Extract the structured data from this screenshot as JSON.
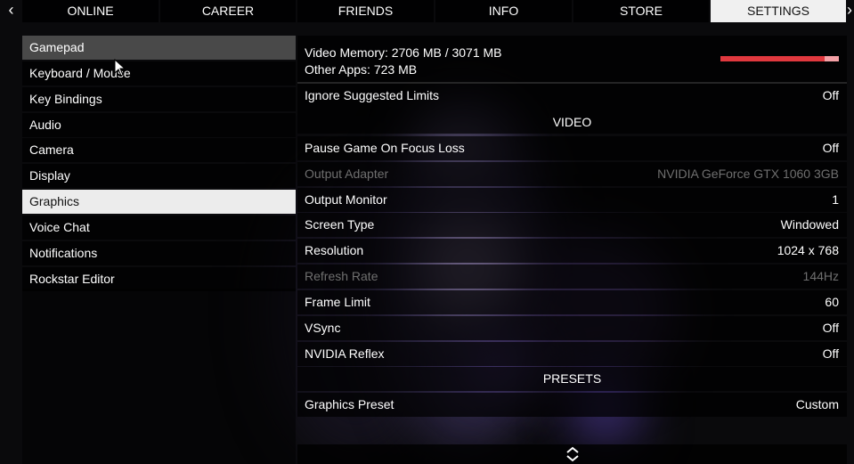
{
  "nav": {
    "prev_arrow": "‹",
    "next_arrow": "›",
    "tabs": [
      {
        "label": "ONLINE"
      },
      {
        "label": "CAREER"
      },
      {
        "label": "FRIENDS"
      },
      {
        "label": "INFO"
      },
      {
        "label": "STORE"
      },
      {
        "label": "SETTINGS",
        "active": true
      }
    ]
  },
  "sidebar": {
    "items": [
      {
        "label": "Gamepad"
      },
      {
        "label": "Keyboard / Mouse"
      },
      {
        "label": "Key Bindings"
      },
      {
        "label": "Audio"
      },
      {
        "label": "Camera"
      },
      {
        "label": "Display"
      },
      {
        "label": "Graphics",
        "active": true
      },
      {
        "label": "Voice Chat"
      },
      {
        "label": "Notifications"
      },
      {
        "label": "Rockstar Editor"
      }
    ]
  },
  "memory": {
    "video_memory": "Video Memory: 2706 MB / 3071 MB",
    "other_apps": "Other Apps: 723 MB",
    "bar_color": "#e0383e",
    "usage_fraction": 0.88
  },
  "settings": {
    "ignore_limits": {
      "label": "Ignore Suggested Limits",
      "value": "Off"
    },
    "video_header": "VIDEO",
    "rows": [
      {
        "label": "Pause Game On Focus Loss",
        "value": "Off"
      },
      {
        "label": "Output Adapter",
        "value": "NVIDIA GeForce GTX 1060 3GB",
        "disabled": true
      },
      {
        "label": "Output Monitor",
        "value": "1"
      },
      {
        "label": "Screen Type",
        "value": "Windowed"
      },
      {
        "label": "Resolution",
        "value": "1024 x 768"
      },
      {
        "label": "Refresh Rate",
        "value": "144Hz",
        "disabled": true
      },
      {
        "label": "Frame Limit",
        "value": "60"
      },
      {
        "label": "VSync",
        "value": "Off"
      },
      {
        "label": "NVIDIA Reflex",
        "value": "Off"
      }
    ],
    "presets_header": "PRESETS",
    "graphics_preset": {
      "label": "Graphics Preset",
      "value": "Custom"
    }
  },
  "icons": {
    "scroll": "chevron-up-down-icon",
    "cursor": "mouse-cursor-icon"
  }
}
